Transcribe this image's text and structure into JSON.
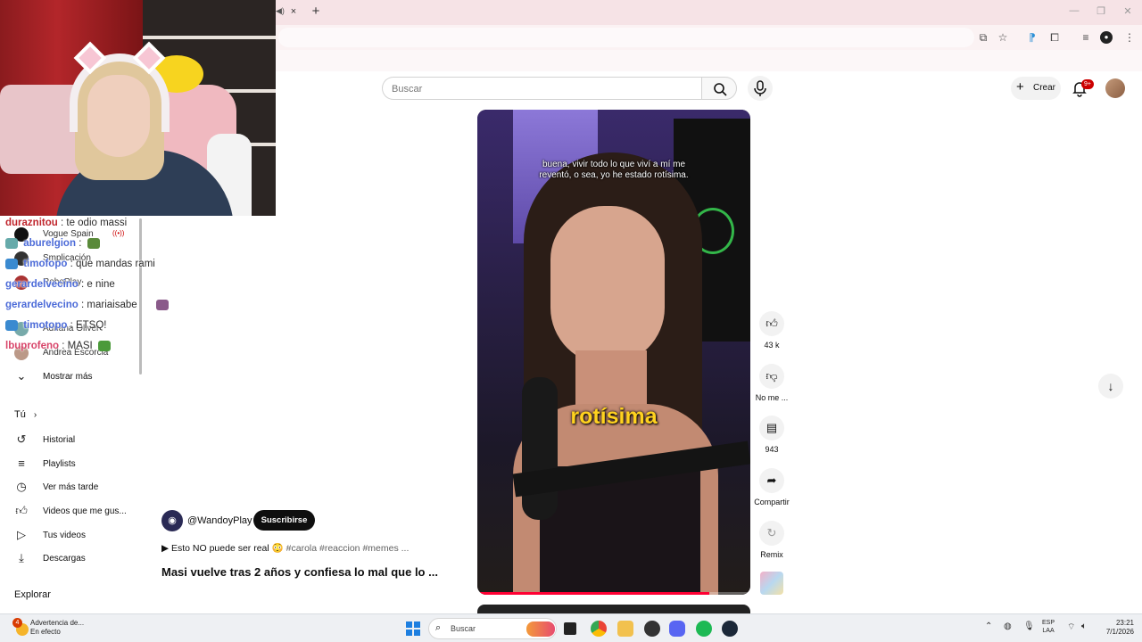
{
  "browser": {
    "tab_close": "×",
    "new_tab": "+",
    "window_controls": [
      "—",
      "❐",
      "✕"
    ]
  },
  "chat": {
    "lines": [
      {
        "user": "duraznitou",
        "msg": ": te odio massi",
        "user_color": "#c0262d"
      },
      {
        "user": "aburelgion",
        "msg": ":",
        "user_color": "#3b6fd8"
      },
      {
        "user": "timofopo",
        "msg": ": que mandas rami",
        "user_color": "#3b6fd8"
      },
      {
        "user": "gerardelvecino",
        "msg": ": e nine",
        "user_color": "#3b6fd8"
      },
      {
        "user": "gerardelvecino",
        "msg": ": mariaisabe",
        "user_color": "#3b6fd8"
      },
      {
        "user": "timotopo",
        "msg": ": ETSQ!",
        "user_color": "#3b6fd8"
      },
      {
        "user": "lbuprofeno",
        "msg": ": MASI",
        "user_color": "#d8456a"
      }
    ]
  },
  "sidebar": {
    "subscriptions": [
      {
        "name": "Vogue Spain",
        "live": true
      },
      {
        "name": "Smplicación",
        "live": false
      },
      {
        "name": "RoboPlay",
        "live": false
      },
      {
        "name": "Adriana Oliver",
        "live": false
      },
      {
        "name": "Andrea Escorcia",
        "live": false
      }
    ],
    "show_more": "Mostrar más",
    "you_heading": "Tú",
    "you_items": [
      {
        "label": "Historial",
        "icon": "history-icon"
      },
      {
        "label": "Playlists",
        "icon": "playlists-icon"
      },
      {
        "label": "Ver más tarde",
        "icon": "watch-later-icon"
      },
      {
        "label": "Videos que me gus...",
        "icon": "liked-videos-icon"
      },
      {
        "label": "Tus videos",
        "icon": "your-videos-icon"
      },
      {
        "label": "Descargas",
        "icon": "downloads-icon"
      }
    ],
    "explore_heading": "Explorar"
  },
  "masthead": {
    "search_placeholder": "Buscar",
    "create_label": "Crear",
    "notification_count": "9+"
  },
  "video": {
    "subtitle": "buena, vivir todo lo que viví a mí me\nreventó, o sea, yo he estado rotísima.",
    "caption": "rotísima",
    "progress": 0.85
  },
  "actions": {
    "likes": "43 k",
    "dislike_label": "No me ...",
    "comments": "943",
    "share_label": "Compartir",
    "remix_label": "Remix"
  },
  "channel": {
    "handle": "@WandoyPlay",
    "subscribe_label": "Suscribirse",
    "description_lead": "▶ Esto NO puede ser real 😳",
    "hashtags": "#carola #reaccion #memes ...",
    "title": "Masi vuelve tras 2 años y confiesa lo mal que lo ..."
  },
  "taskbar": {
    "weather_line1": "Advertencia de...",
    "weather_line2": "En efecto",
    "search_placeholder": "Buscar",
    "lang_line1": "ESP",
    "lang_line2": "LAA",
    "time": "23:21",
    "date": "7/1/2026"
  },
  "colors": {
    "accent_red": "#ff0033",
    "caption_yellow": "#ffd21f",
    "badge_red": "#cc0000",
    "subscribe_bg": "#0f0f0f"
  }
}
